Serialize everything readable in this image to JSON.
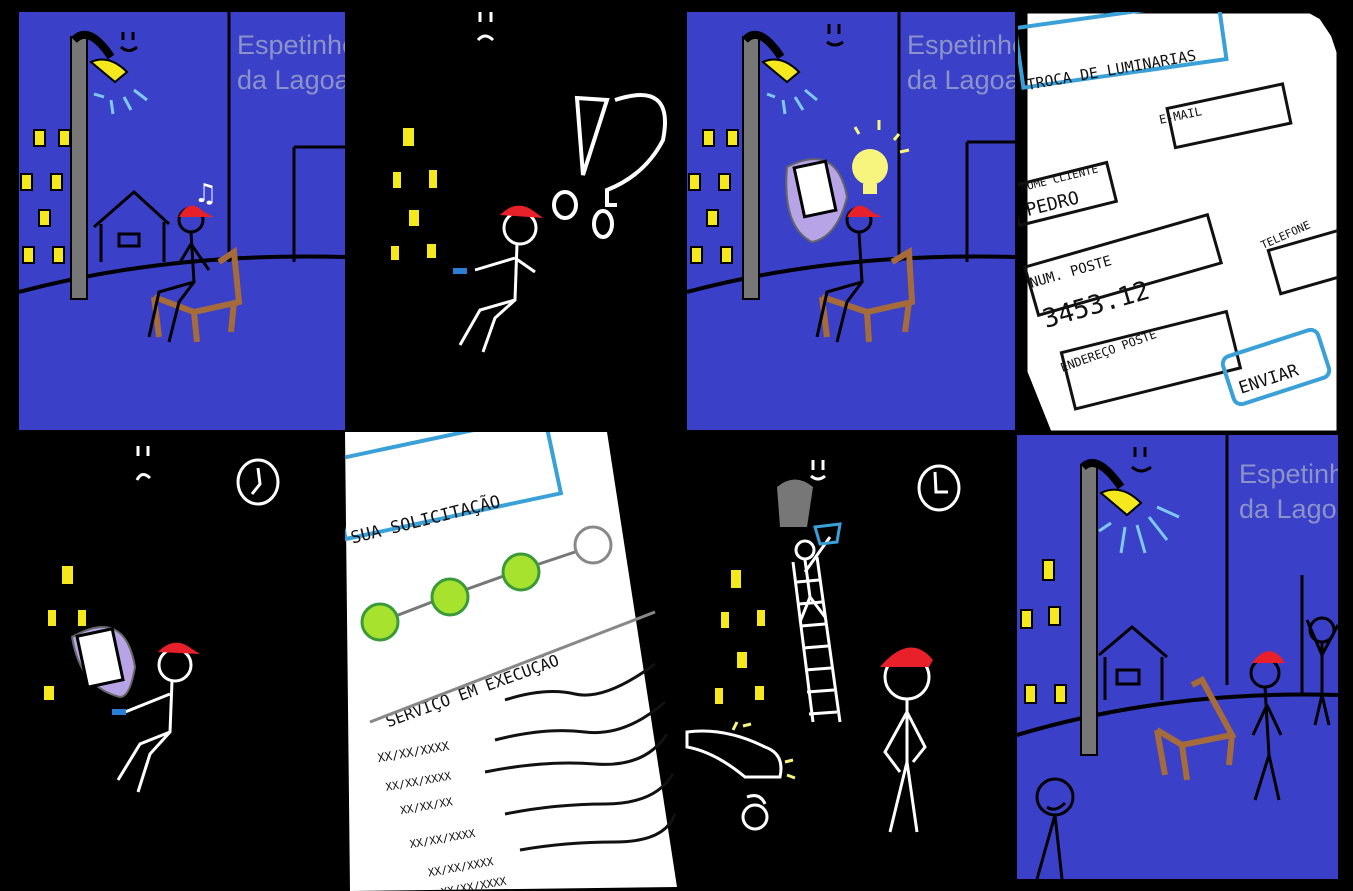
{
  "sign": {
    "line1": "Espetinho",
    "line2": "da Lagoa"
  },
  "notes": "♫",
  "form": {
    "title": "TROCA DE LUMINARIAS",
    "email_label": "E-MAIL",
    "name_label": "NOME CLIENTE",
    "name_value": "PEDRO",
    "pole_label": "NUM. POSTE",
    "pole_value": "3453.12",
    "phone_label": "TELEFONE",
    "address_label": "ENDEREÇO POSTE",
    "send_label": "ENVIAR"
  },
  "status": {
    "title": "SUA SOLICITAÇÃO",
    "progress_steps_total": 4,
    "progress_steps_done": 3,
    "status_text": "SERVIÇO EM EXECUÇÃO",
    "rows": [
      "XX/XX/XXXX",
      "XX/XX/XXXX",
      "XX/XX/XX",
      "XX/XX/XXXX",
      "XX/XX/XXXX",
      "XX/XX/XXXX"
    ]
  },
  "colors": {
    "sky": "#3a40c8",
    "lamp": "#f5e81c",
    "cap": "#e8202a",
    "progress": "#a6e22e",
    "accent": "#3aa0d8"
  }
}
